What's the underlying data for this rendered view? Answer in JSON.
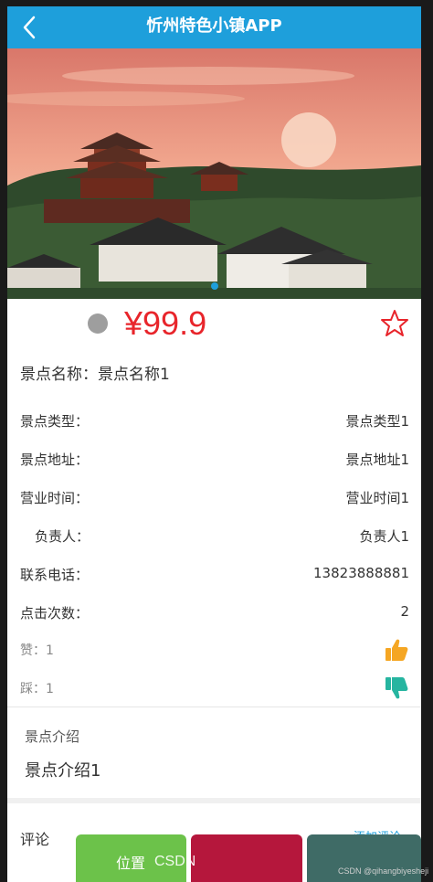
{
  "header": {
    "title": "忻州特色小镇APP"
  },
  "product": {
    "price": "¥99.9",
    "name_label": "景点名称：",
    "name_value": "景点名称1"
  },
  "info": [
    {
      "label": "景点类型：",
      "value": "景点类型1"
    },
    {
      "label": "景点地址：",
      "value": "景点地址1"
    },
    {
      "label": "营业时间：",
      "value": "营业时间1"
    },
    {
      "label": "负责人：",
      "value": "负责人1"
    },
    {
      "label": "联系电话：",
      "value": "13823888881"
    },
    {
      "label": "点击次数：",
      "value": "2"
    }
  ],
  "votes": {
    "like_label": "赞：1",
    "dislike_label": "踩：1"
  },
  "intro": {
    "title": "景点介绍",
    "text": "景点介绍1"
  },
  "comments": {
    "title": "评论",
    "link": "添加评论"
  },
  "bottom_bar": {
    "position_label": "位置"
  },
  "watermark": {
    "center": "CSDN",
    "right": "CSDN @qihangbiyesheji"
  },
  "colors": {
    "header": "#1e9fdb",
    "price": "#e8252b",
    "like": "#f5a623",
    "dislike": "#26b5a0"
  },
  "icons": [
    "back-arrow-icon",
    "star-outline-icon",
    "thumbs-up-icon",
    "thumbs-down-icon"
  ]
}
